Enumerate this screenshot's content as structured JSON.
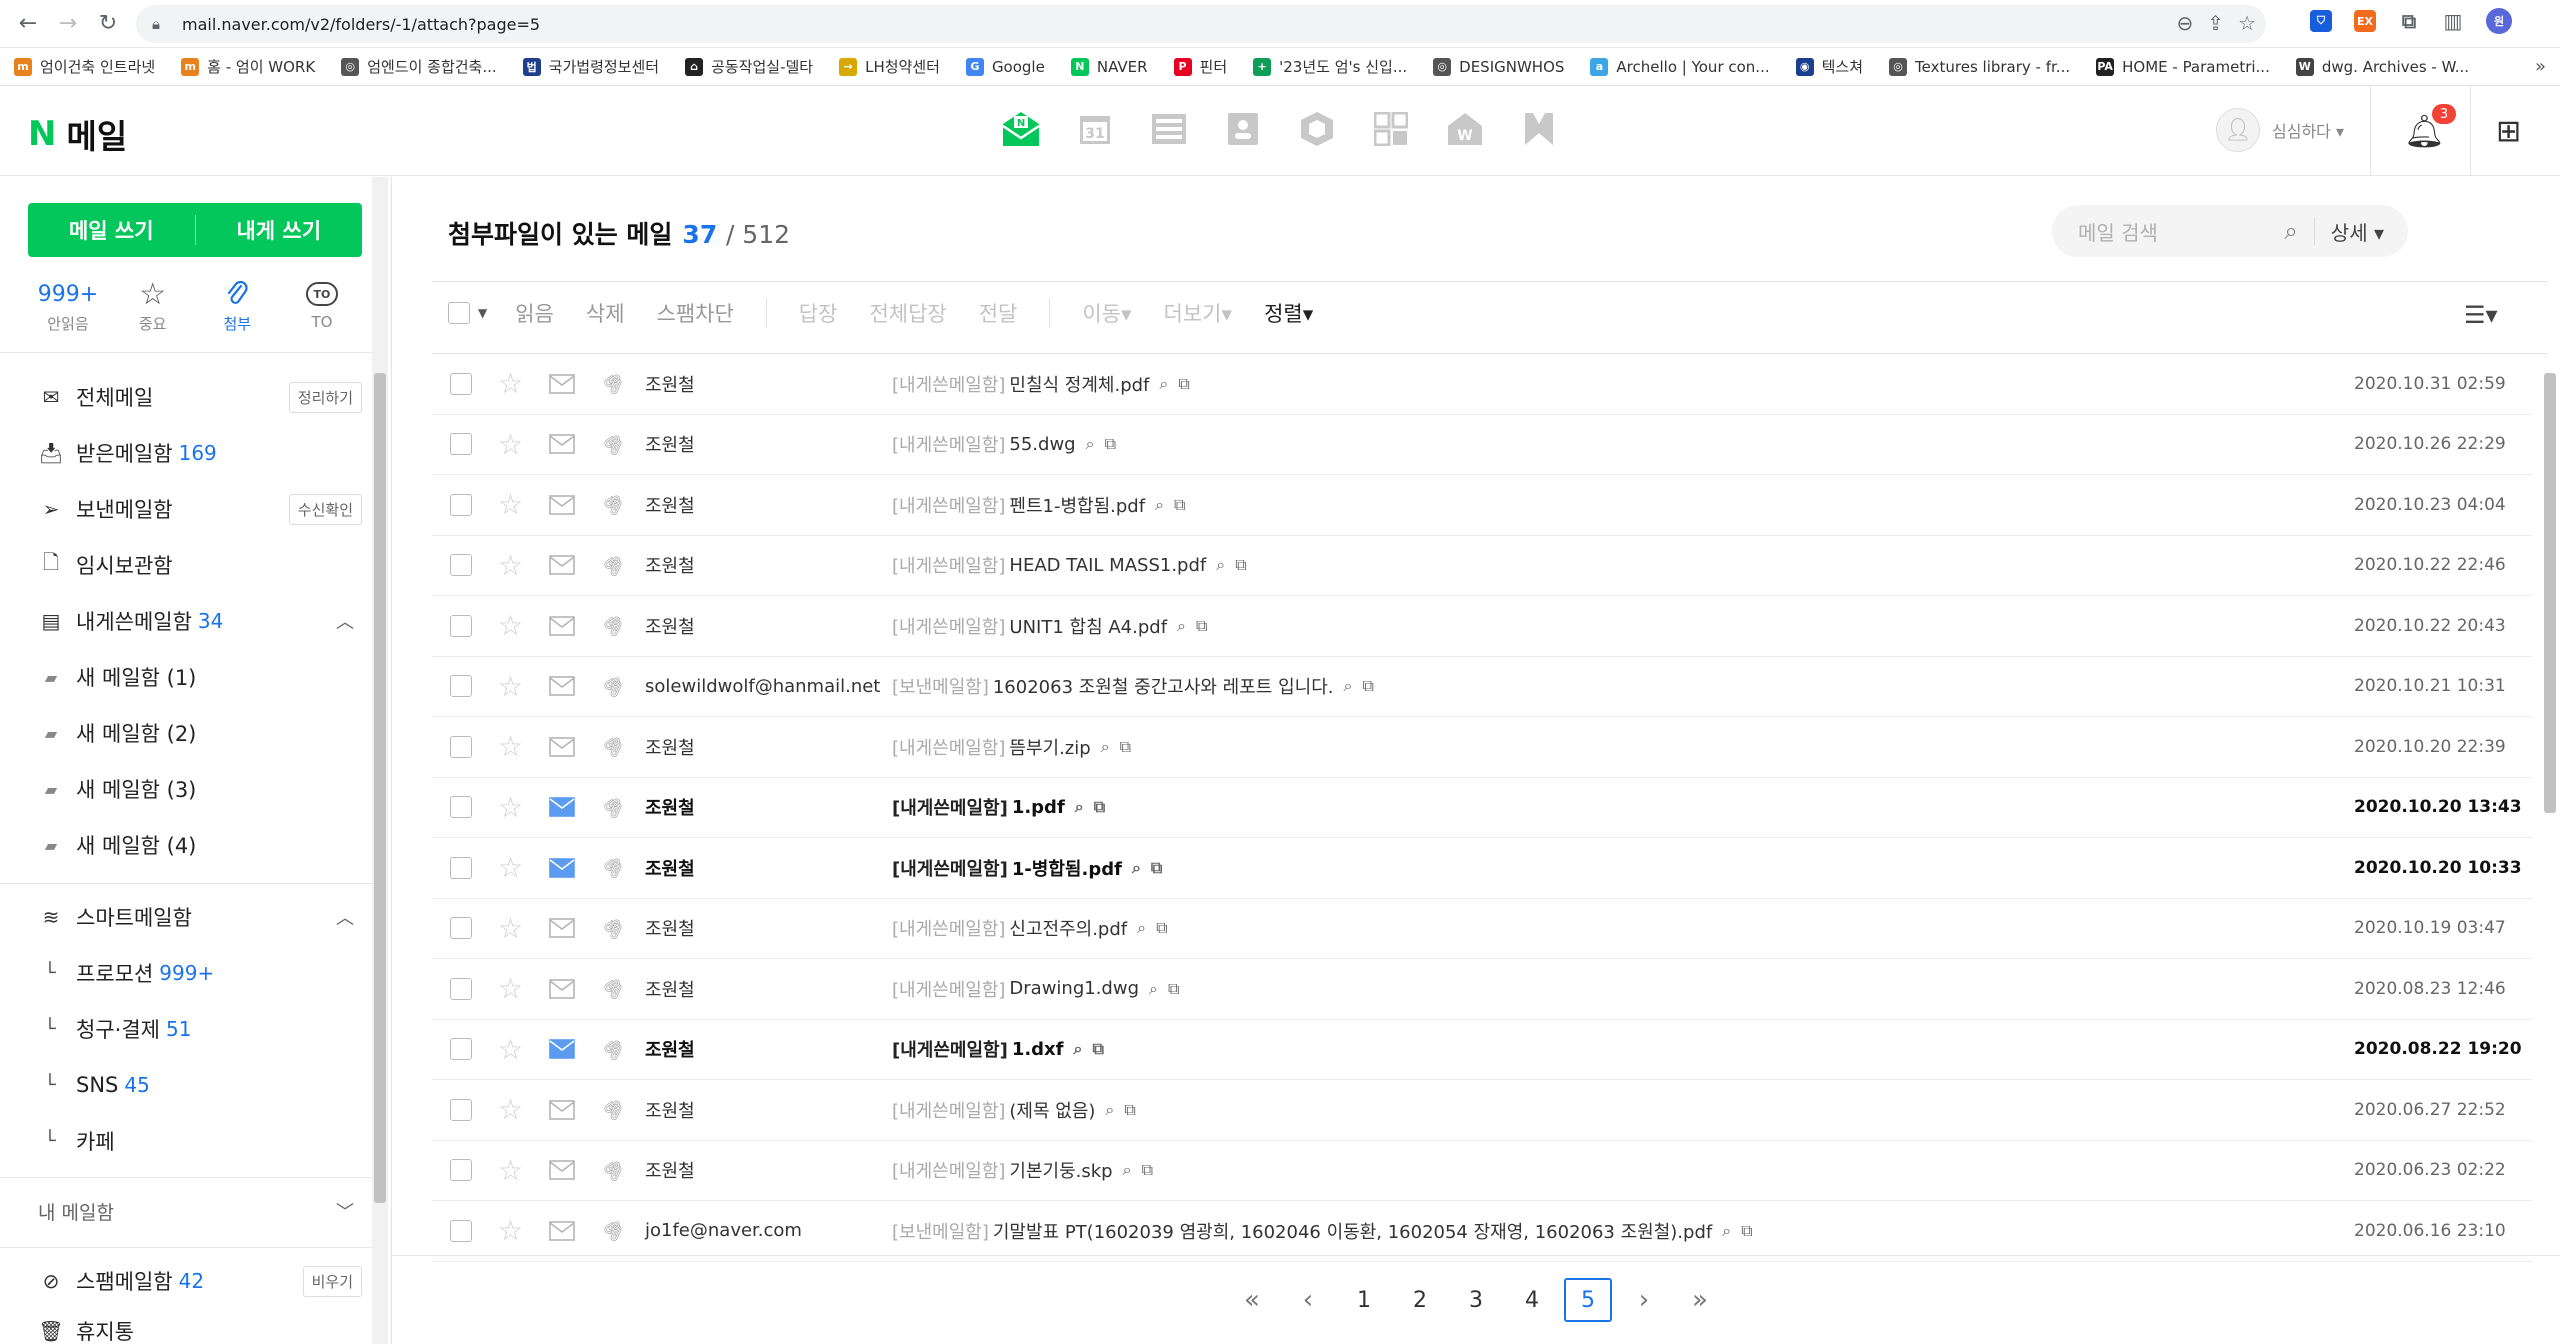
{
  "browser": {
    "url": "mail.naver.com/v2/folders/-1/attach?page=5",
    "bookmarks": [
      {
        "label": "엄이건축 인트라넷",
        "color": "#e8821e",
        "glyph": "m"
      },
      {
        "label": "홈 - 엄이 WORK",
        "color": "#e8821e",
        "glyph": "m"
      },
      {
        "label": "엄엔드이 종합건축...",
        "color": "#555555",
        "glyph": "◎"
      },
      {
        "label": "국가법령정보센터",
        "color": "#1d3f8c",
        "glyph": "법"
      },
      {
        "label": "공동작업실-델타",
        "color": "#222222",
        "glyph": "⌂"
      },
      {
        "label": "LH청약센터",
        "color": "#d7a800",
        "glyph": "→"
      },
      {
        "label": "Google",
        "color": "#4285f4",
        "glyph": "G"
      },
      {
        "label": "NAVER",
        "color": "#03c75a",
        "glyph": "N"
      },
      {
        "label": "핀터",
        "color": "#e60023",
        "glyph": "P"
      },
      {
        "label": "'23년도 엄's 신입...",
        "color": "#0f9d58",
        "glyph": "+"
      },
      {
        "label": "DESIGNWHOS",
        "color": "#555555",
        "glyph": "◎"
      },
      {
        "label": "Archello | Your con...",
        "color": "#3aa6e6",
        "glyph": "a"
      },
      {
        "label": "텍스쳐",
        "color": "#1a3f8c",
        "glyph": "◉"
      },
      {
        "label": "Textures library - fr...",
        "color": "#555555",
        "glyph": "◎"
      },
      {
        "label": "HOME - Parametri...",
        "color": "#222222",
        "glyph": "PA"
      },
      {
        "label": "dwg. Archives - W...",
        "color": "#444444",
        "glyph": "W"
      }
    ],
    "more": "»"
  },
  "header": {
    "logo_n": "N",
    "logo_text": "메일",
    "user_name": "심심하다 ▾",
    "notification_count": "3"
  },
  "sidebar": {
    "compose_label": "메일 쓰기",
    "self_compose_label": "내게 쓰기",
    "quick": [
      {
        "top": "999+",
        "label": "안읽음"
      },
      {
        "top": "☆",
        "label": "중요"
      },
      {
        "top": "📎",
        "label": "첨부"
      },
      {
        "top": "TO",
        "label": "TO"
      }
    ],
    "folders": [
      {
        "label": "전체메일",
        "count": "",
        "pill": "정리하기"
      },
      {
        "label": "받은메일함",
        "count": "169",
        "pill": ""
      },
      {
        "label": "보낸메일함",
        "count": "",
        "pill": "수신확인"
      },
      {
        "label": "임시보관함",
        "count": "",
        "pill": ""
      },
      {
        "label": "내게쓴메일함",
        "count": "34",
        "pill": ""
      }
    ],
    "subfolders": [
      "새 메일함 (1)",
      "새 메일함 (2)",
      "새 메일함 (3)",
      "새 메일함 (4)"
    ],
    "smart_label": "스마트메일함",
    "smart_items": [
      {
        "label": "프로모션",
        "count": "999+"
      },
      {
        "label": "청구·결제",
        "count": "51"
      },
      {
        "label": "SNS",
        "count": "45"
      },
      {
        "label": "카페",
        "count": ""
      }
    ],
    "my_mailbox_label": "내 메일함",
    "spam_label": "스팸메일함",
    "spam_count": "42",
    "spam_pill": "비우기",
    "trash_label": "휴지통"
  },
  "main": {
    "title": "첨부파일이 있는 메일",
    "count": "37",
    "total": "/ 512",
    "search_placeholder": "메일 검색",
    "search_detail": "상세 ▾",
    "toolbar": {
      "read": "읽음",
      "delete": "삭제",
      "spam": "스팸차단",
      "reply": "답장",
      "reply_all": "전체답장",
      "forward": "전달",
      "move": "이동▾",
      "more": "더보기▾",
      "sort": "정렬▾"
    },
    "rows": [
      {
        "sender": "조원철",
        "tag": "[내게쓴메일함]",
        "subject": "민칠식 정계체.pdf",
        "date": "2020.10.31 02:59",
        "unread": false
      },
      {
        "sender": "조원철",
        "tag": "[내게쓴메일함]",
        "subject": "55.dwg",
        "date": "2020.10.26 22:29",
        "unread": false
      },
      {
        "sender": "조원철",
        "tag": "[내게쓴메일함]",
        "subject": "펜트1-병합됨.pdf",
        "date": "2020.10.23 04:04",
        "unread": false
      },
      {
        "sender": "조원철",
        "tag": "[내게쓴메일함]",
        "subject": "HEAD TAIL MASS1.pdf",
        "date": "2020.10.22 22:46",
        "unread": false
      },
      {
        "sender": "조원철",
        "tag": "[내게쓴메일함]",
        "subject": "UNIT1 합침 A4.pdf",
        "date": "2020.10.22 20:43",
        "unread": false
      },
      {
        "sender": "solewildwolf@hanmail.net",
        "tag": "[보낸메일함]",
        "subject": "1602063 조원철 중간고사와 레포트 입니다.",
        "date": "2020.10.21 10:31",
        "unread": false
      },
      {
        "sender": "조원철",
        "tag": "[내게쓴메일함]",
        "subject": "뜸부기.zip",
        "date": "2020.10.20 22:39",
        "unread": false
      },
      {
        "sender": "조원철",
        "tag": "[내게쓴메일함]",
        "subject": "1.pdf",
        "date": "2020.10.20 13:43",
        "unread": true
      },
      {
        "sender": "조원철",
        "tag": "[내게쓴메일함]",
        "subject": "1-병합됨.pdf",
        "date": "2020.10.20 10:33",
        "unread": true
      },
      {
        "sender": "조원철",
        "tag": "[내게쓴메일함]",
        "subject": "신고전주의.pdf",
        "date": "2020.10.19 03:47",
        "unread": false
      },
      {
        "sender": "조원철",
        "tag": "[내게쓴메일함]",
        "subject": "Drawing1.dwg",
        "date": "2020.08.23 12:46",
        "unread": false
      },
      {
        "sender": "조원철",
        "tag": "[내게쓴메일함]",
        "subject": "1.dxf",
        "date": "2020.08.22 19:20",
        "unread": true
      },
      {
        "sender": "조원철",
        "tag": "[내게쓴메일함]",
        "subject": "(제목 없음)",
        "date": "2020.06.27 22:52",
        "unread": false
      },
      {
        "sender": "조원철",
        "tag": "[내게쓴메일함]",
        "subject": "기본기둥.skp",
        "date": "2020.06.23 02:22",
        "unread": false
      },
      {
        "sender": "jo1fe@naver.com",
        "tag": "[보낸메일함]",
        "subject": "기말발표 PT(1602039 염광희, 1602046 이동환, 1602054 장재영, 1602063 조원철).pdf",
        "date": "2020.06.16 23:10",
        "unread": false
      }
    ],
    "pages": [
      "1",
      "2",
      "3",
      "4",
      "5"
    ],
    "current_page": "5"
  },
  "colors": {
    "brand": "#03c75a",
    "accent": "#1a73e8",
    "unread_envelope": "#5b9bf0"
  }
}
